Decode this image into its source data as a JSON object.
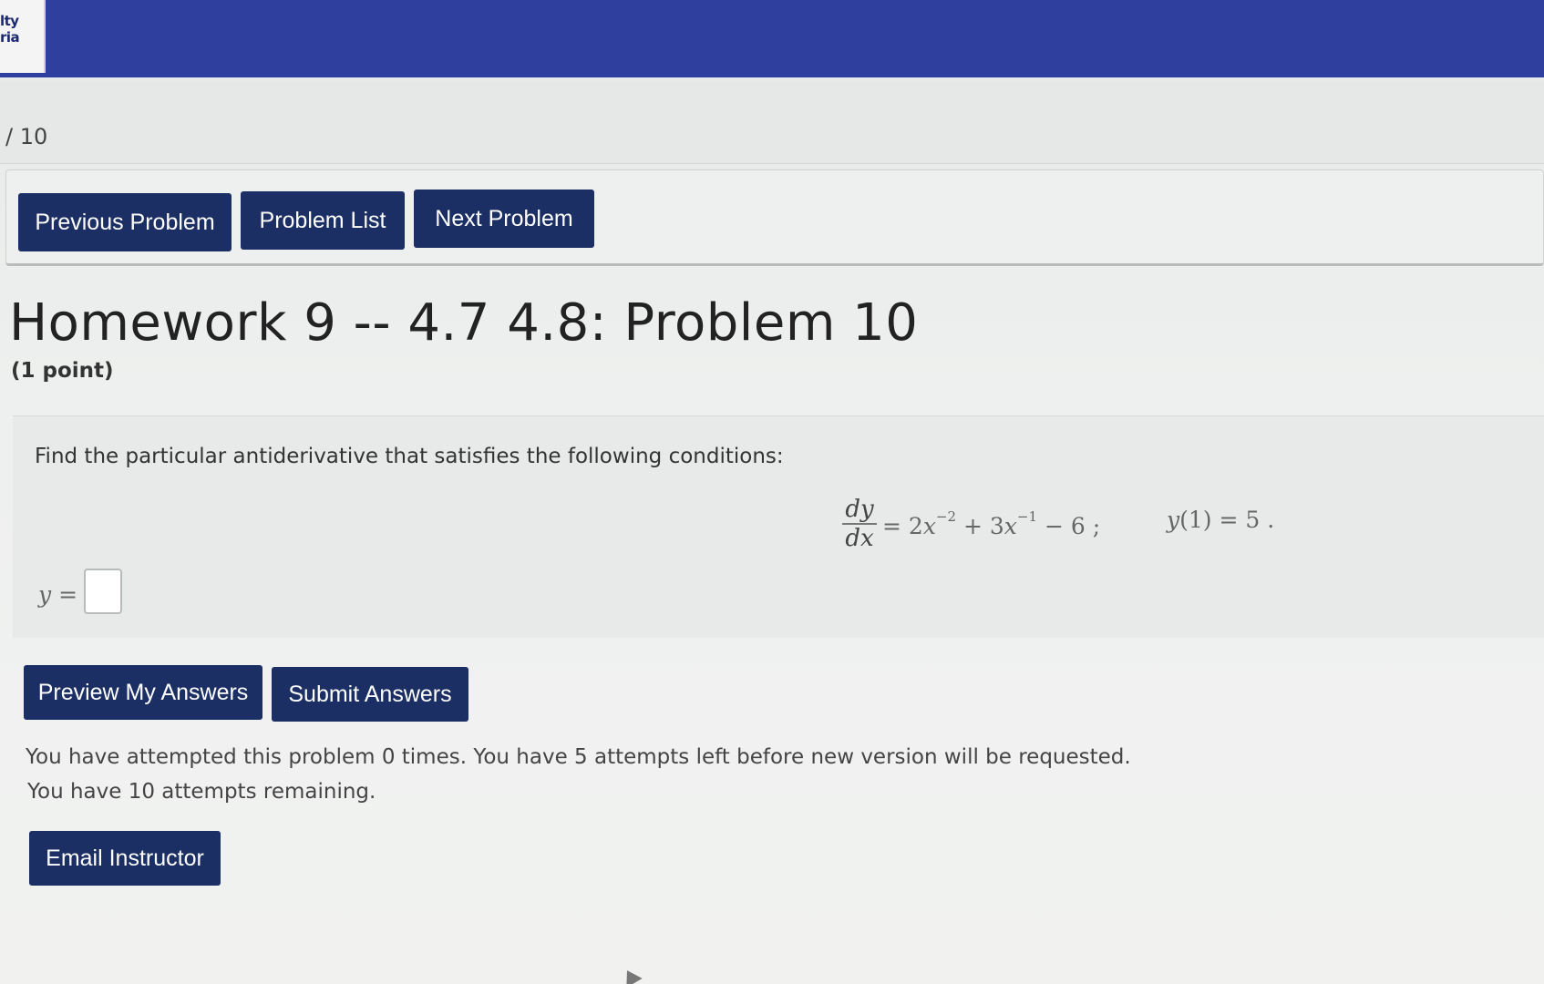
{
  "header": {
    "logo_line1": "lty",
    "logo_line2": "ria",
    "brand_color": "#2f3f9e"
  },
  "problem_counter": "/ 10",
  "nav": {
    "previous_label": "Previous Problem",
    "list_label": "Problem List",
    "next_label": "Next Problem",
    "button_color": "#1b2f64"
  },
  "problem": {
    "title": "Homework 9 -- 4.7 4.8: Problem 10",
    "points": "(1 point)",
    "instruction": "Find the particular antiderivative that satisfies the following conditions:",
    "equation": {
      "numerator": "dy",
      "denominator": "dx",
      "rhs_prefix": "= 2",
      "var1": "x",
      "exp1": "−2",
      "mid": " + 3",
      "var2": "x",
      "exp2": "−1",
      "tail": " − 6 ;"
    },
    "condition": {
      "fn": "y",
      "arg": "(1) = 5 ."
    },
    "answer_label_var": "y",
    "answer_label_eq": " =",
    "answer_value": ""
  },
  "actions": {
    "preview_label": "Preview My Answers",
    "submit_label": "Submit Answers",
    "email_label": "Email Instructor"
  },
  "status": {
    "attempts_line1": "You have attempted this problem 0 times. You have 5 attempts left before new version will be requested.",
    "attempts_line2": "You have 10 attempts remaining."
  }
}
